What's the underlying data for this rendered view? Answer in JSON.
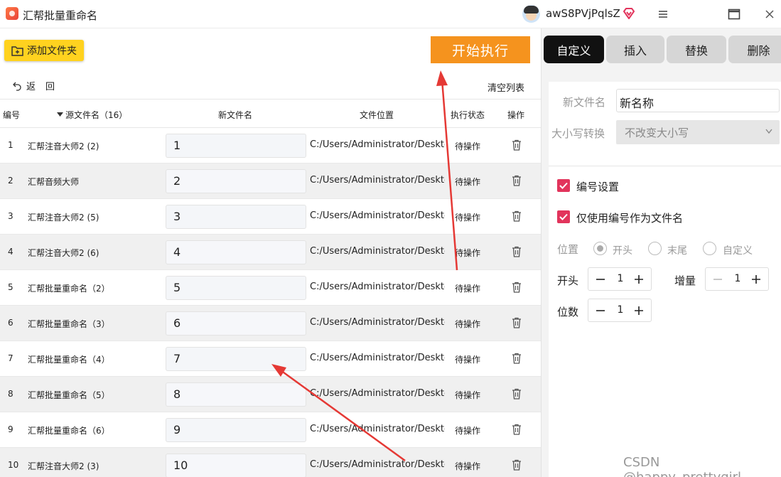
{
  "app": {
    "title": "汇帮批量重命名"
  },
  "user": {
    "name": "awS8PVjPqlsZ"
  },
  "toolbar": {
    "add_folder": "添加文件夹",
    "start": "开始执行",
    "back": "返回",
    "clear_list": "清空列表"
  },
  "table": {
    "headers": {
      "no": "编号",
      "source": "源文件名（16）",
      "new_name": "新文件名",
      "location": "文件位置",
      "status": "执行状态",
      "op": "操作"
    },
    "rows": [
      {
        "no": "1",
        "source": "汇帮注音大师2 (2)",
        "new_name": "1",
        "location": "C:/Users/Administrator/Desktop,",
        "status": "待操作"
      },
      {
        "no": "2",
        "source": "汇帮音频大师",
        "new_name": "2",
        "location": "C:/Users/Administrator/Desktop,",
        "status": "待操作"
      },
      {
        "no": "3",
        "source": "汇帮注音大师2 (5)",
        "new_name": "3",
        "location": "C:/Users/Administrator/Desktop,",
        "status": "待操作"
      },
      {
        "no": "4",
        "source": "汇帮注音大师2 (6)",
        "new_name": "4",
        "location": "C:/Users/Administrator/Desktop,",
        "status": "待操作"
      },
      {
        "no": "5",
        "source": "汇帮批量重命名（2）",
        "new_name": "5",
        "location": "C:/Users/Administrator/Desktop,",
        "status": "待操作"
      },
      {
        "no": "6",
        "source": "汇帮批量重命名（3）",
        "new_name": "6",
        "location": "C:/Users/Administrator/Desktop,",
        "status": "待操作"
      },
      {
        "no": "7",
        "source": "汇帮批量重命名（4）",
        "new_name": "7",
        "location": "C:/Users/Administrator/Desktop,",
        "status": "待操作"
      },
      {
        "no": "8",
        "source": "汇帮批量重命名（5）",
        "new_name": "8",
        "location": "C:/Users/Administrator/Desktop,",
        "status": "待操作"
      },
      {
        "no": "9",
        "source": "汇帮批量重命名（6）",
        "new_name": "9",
        "location": "C:/Users/Administrator/Desktop,",
        "status": "待操作"
      },
      {
        "no": "10",
        "source": "汇帮注音大师2 (3)",
        "new_name": "10",
        "location": "C:/Users/Administrator/Desktop,",
        "status": "待操作"
      }
    ]
  },
  "tabs": [
    {
      "label": "自定义",
      "active": true
    },
    {
      "label": "插入"
    },
    {
      "label": "替换"
    },
    {
      "label": "删除"
    }
  ],
  "settings": {
    "new_name_label": "新文件名",
    "new_name_value": "新名称",
    "case_label": "大小写转换",
    "case_value": "不改变大小写",
    "numbering_label": "编号设置",
    "numbering_checked": true,
    "only_number_label": "仅使用编号作为文件名",
    "only_number_checked": true,
    "position_label": "位置",
    "position_options": [
      "开头",
      "末尾",
      "自定义"
    ],
    "position_selected": "开头",
    "start_label": "开头",
    "start_value": "1",
    "increment_label": "增量",
    "increment_value": "1",
    "digits_label": "位数",
    "digits_value": "1"
  },
  "watermark": "CSDN @happy_prettygirl",
  "colors": {
    "start_button": "#f5931e",
    "add_folder_button": "#ffd21f",
    "checkbox": "#e2345c",
    "active_tab": "#111111",
    "arrow": "#e53935"
  },
  "icons": [
    "app-logo-icon",
    "avatar-icon",
    "vip-diamond-icon",
    "menu-icon",
    "maximize-icon",
    "close-icon",
    "folder-add-icon",
    "back-arrow-icon",
    "sort-down-icon",
    "trash-icon",
    "chevron-down-icon",
    "minus-icon",
    "plus-icon",
    "check-icon"
  ]
}
